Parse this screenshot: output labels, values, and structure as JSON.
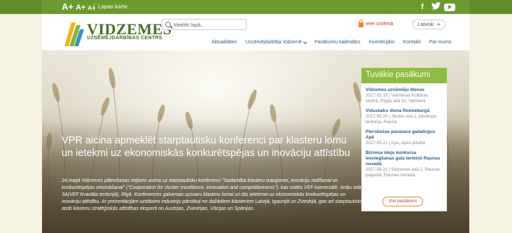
{
  "topbar": {
    "font_sizes": [
      "A+",
      "A+",
      "A+"
    ],
    "site_map_link": "Lapas karte",
    "social": [
      {
        "icon": "facebook-icon",
        "glyph": "f"
      },
      {
        "icon": "twitter-icon",
        "glyph": "🐦"
      },
      {
        "icon": "youtube-icon",
        "glyph": ""
      }
    ],
    "colors": {
      "bar": "#6b9b2f"
    }
  },
  "header": {
    "logo_title": "VIDZEMES",
    "logo_subtitle": "UZŅĒMĒJDARBĪBAS CENTRS",
    "search_placeholder": "Meklēt lapā...",
    "login_label": "Ieiet sistēmā",
    "language": "Latviski",
    "nav": [
      "Aktualitātes",
      "Uzņēmējdarbība Vidzemē",
      "Pasākumu kalendārs",
      "Investīcijām",
      "Kontakti",
      "Par mums"
    ]
  },
  "hero": {
    "title": "VPR aicina apmeklēt starptautisku konferenci par klasteru lomu un ietekmi uz ekonomiskās konkurētspējas un inovāciju attīstību",
    "text": "24.maijā Vidzemes plānošanas reģions aicina uz starptautisku konferenci \"Sadarbība klasteru izaugsmei, inovāciju radīšanai un konkurētspējas veicināšanai\" (\"Cooperation for cluster excellence, innovation and competitiveness\"), kas notiks VEF kamerzālē, Ieriķu ielā 3A(VEF Kvartāla teritorijā), Rīgā. Konferences galvenais uzsvars klasteru lomai un tās ietekmei uz ekonomiskās konkurētspējas un inovāciju attīstību. Ar prezentācijām uzstāsies industriju pārstāvji no dažādiem klasteriem Latvijā, Igaunijā un Zviedrijā, gan arī starptautiski atzīti klasteru stratēģiskās attīstības eksperti no Austrijas, Zviedrijas, Vācijas un Spānijas."
  },
  "events": {
    "heading": "Tuvākie pasākumi",
    "items": [
      {
        "title": "Vidzemes uzņēmēju dienas",
        "info": "2017.05.19 | Valmieras Kultūras centrā, Rīgas ielā 10, Valmierā"
      },
      {
        "title": "Viduslaiku diena Ronneburgā",
        "info": "2017.05.20 | Skolas iela 1, pilsdrupu teritorija, Rauna"
      },
      {
        "title": "Pierobežas pavasara gadatirgus Apē",
        "info": "2017.05.21 | Ape, Apes pilsēta"
      },
      {
        "title": "Biznesa ideju konkursa iesniegšanas gala termiņš Raunas novadā",
        "info": "2017.06.22 | Vidzemes ielā 2, Raunas pagastā, Raunas novadā."
      }
    ],
    "all_button": "Visi pasākumi",
    "colors": {
      "header": "#8cbd3f",
      "link": "#2d5c8a",
      "button_border": "#e0892a"
    }
  }
}
